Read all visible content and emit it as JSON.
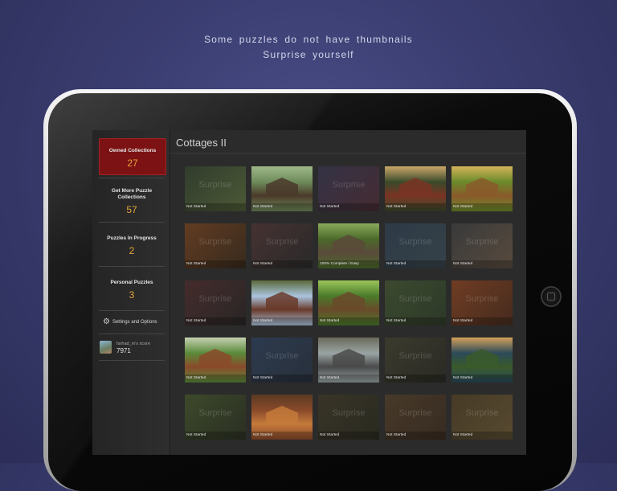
{
  "captions": [
    "Some puzzles do not have thumbnails",
    "Surprise yourself"
  ],
  "sidebar": {
    "items": [
      {
        "label": "Owned Collections",
        "count": "27"
      },
      {
        "label": "Get More Puzzle Collections",
        "count": "57"
      },
      {
        "label": "Puzzles In Progress",
        "count": "2"
      },
      {
        "label": "Personal Puzzles",
        "count": "3"
      }
    ],
    "settings_label": "Settings and Options",
    "user_name": "farhad_m's score",
    "user_score": "7971"
  },
  "main": {
    "title": "Cottages II",
    "surprise_text": "Surprise",
    "tiles": [
      {
        "kind": "surprise",
        "status": "Not Started",
        "colors": [
          "#2f3d2a",
          "#4a5a2e"
        ]
      },
      {
        "kind": "photo",
        "status": "Not Started",
        "colors": [
          "#6e8a5a",
          "#4a3a2a",
          "#9eb88a"
        ]
      },
      {
        "kind": "surprise",
        "status": "Not Started",
        "colors": [
          "#34324a",
          "#4a2a32"
        ]
      },
      {
        "kind": "photo",
        "status": "Not Started",
        "colors": [
          "#3a4a2a",
          "#7a3424",
          "#caa86a"
        ]
      },
      {
        "kind": "photo",
        "status": "Not Started",
        "colors": [
          "#6a8a2a",
          "#8a5a2a",
          "#d4b45a"
        ]
      },
      {
        "kind": "surprise",
        "status": "Not Started",
        "colors": [
          "#6a3a1a",
          "#3a2a1a"
        ]
      },
      {
        "kind": "surprise",
        "status": "Not Started",
        "colors": [
          "#4a3030",
          "#2a2a2a"
        ]
      },
      {
        "kind": "photo",
        "status": "100% Complete / Easy",
        "colors": [
          "#4a6a2a",
          "#5a4a3a",
          "#8aaa5a"
        ]
      },
      {
        "kind": "surprise",
        "status": "Not Started",
        "colors": [
          "#2a3a4a",
          "#34424a"
        ]
      },
      {
        "kind": "surprise",
        "status": "Not Started",
        "colors": [
          "#3a3a3a",
          "#5a4a3a"
        ]
      },
      {
        "kind": "surprise",
        "status": "Not Started",
        "colors": [
          "#4a2a2a",
          "#2a2626"
        ]
      },
      {
        "kind": "photo",
        "status": "Not Started",
        "colors": [
          "#aac4de",
          "#6a3a2a",
          "#5a6a3a"
        ]
      },
      {
        "kind": "photo",
        "status": "Not Started",
        "colors": [
          "#4a7a2a",
          "#6a4a2a",
          "#9ac45a"
        ]
      },
      {
        "kind": "surprise",
        "status": "Not Started",
        "colors": [
          "#3a4a2a",
          "#2a3a24"
        ]
      },
      {
        "kind": "surprise",
        "status": "Not Started",
        "colors": [
          "#7a3a1a",
          "#4a2a1a"
        ]
      },
      {
        "kind": "photo",
        "status": "Not Started",
        "colors": [
          "#5a8a3a",
          "#8a4a2a",
          "#c4d0b0"
        ]
      },
      {
        "kind": "surprise",
        "status": "Not Started",
        "colors": [
          "#2a3a54",
          "#26303e"
        ]
      },
      {
        "kind": "photo",
        "status": "Not Started",
        "colors": [
          "#9aa4a4",
          "#4a4a4a",
          "#6a6a5a"
        ]
      },
      {
        "kind": "surprise",
        "status": "Not Started",
        "colors": [
          "#3a3a2a",
          "#2a2a24"
        ]
      },
      {
        "kind": "photo",
        "status": "Not Started",
        "colors": [
          "#2a4a5a",
          "#3a5a2a",
          "#d4a05a"
        ]
      },
      {
        "kind": "surprise",
        "status": "Not Started",
        "colors": [
          "#3a4a24",
          "#2a3020"
        ]
      },
      {
        "kind": "photo",
        "status": "Not Started",
        "colors": [
          "#8a4a2a",
          "#c47a3a",
          "#5a3a24"
        ]
      },
      {
        "kind": "surprise",
        "status": "Not Started",
        "colors": [
          "#3a3424",
          "#2a2a1e"
        ]
      },
      {
        "kind": "surprise",
        "status": "Not Started",
        "colors": [
          "#4a3a24",
          "#3a2a1e"
        ]
      },
      {
        "kind": "surprise",
        "status": "Not Started",
        "colors": [
          "#4a3a20",
          "#5a4a2a"
        ]
      }
    ]
  }
}
